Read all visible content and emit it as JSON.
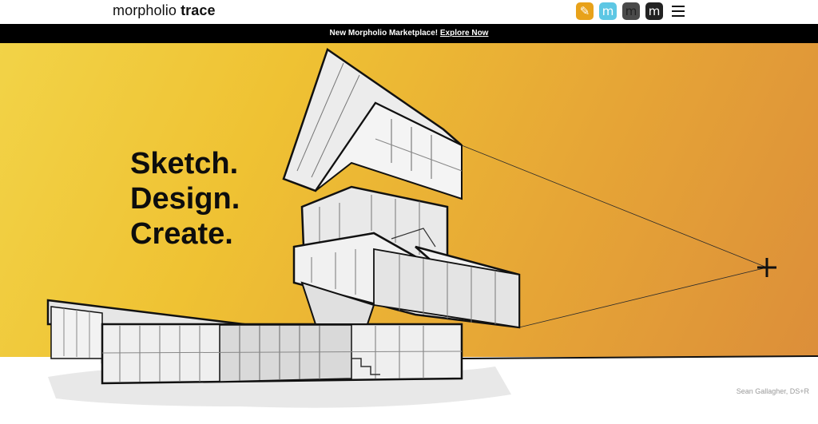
{
  "header": {
    "logo_prefix": "morpholio",
    "logo_suffix": "trace",
    "apps": [
      {
        "name": "trace-app-icon",
        "glyph": "✎",
        "color": "#e8a21a"
      },
      {
        "name": "morpholio-app-icon-blue",
        "glyph": "m",
        "color": "#5dc7e4"
      },
      {
        "name": "morpholio-app-icon-gray",
        "glyph": "m",
        "color": "#4a4a4a"
      },
      {
        "name": "morpholio-app-icon-black",
        "glyph": "m",
        "color": "#222222"
      }
    ],
    "menu_icon": "hamburger-menu-icon"
  },
  "banner": {
    "text": "New Morpholio Marketplace!",
    "link": "Explore Now"
  },
  "hero": {
    "lines": [
      "Sketch.",
      "Design.",
      "Create."
    ],
    "credit": "Sean Gallagher, DS+R",
    "gradient_colors": [
      "#f2d347",
      "#efc233",
      "#e6a536",
      "#db8c3a"
    ]
  }
}
